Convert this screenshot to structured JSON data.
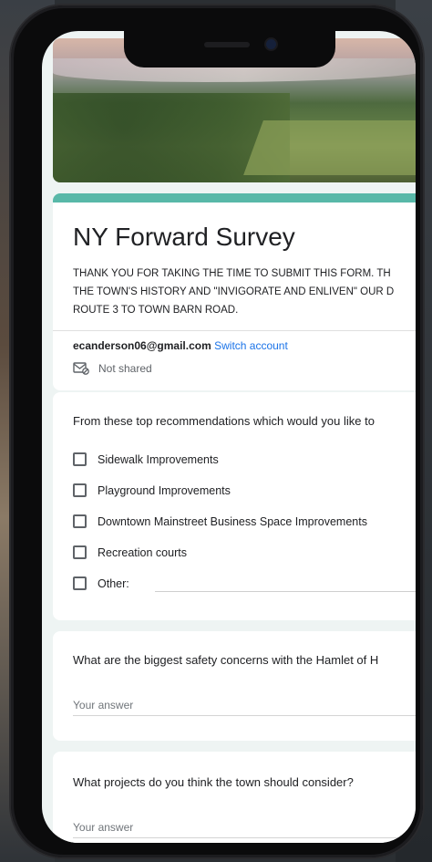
{
  "form": {
    "title": "NY Forward Survey",
    "description_lines": [
      "THANK YOU FOR TAKING THE TIME TO SUBMIT THIS FORM. TH",
      "THE TOWN'S HISTORY AND \"INVIGORATE AND ENLIVEN\" OUR D",
      "ROUTE 3 TO TOWN BARN ROAD."
    ],
    "account_email": "ecanderson06@gmail.com",
    "switch_account_label": "Switch account",
    "not_shared_label": "Not shared"
  },
  "questions": {
    "q1": {
      "text": "From these top recommendations which would you like to",
      "options": [
        "Sidewalk Improvements",
        "Playground Improvements",
        "Downtown Mainstreet Business Space Improvements",
        "Recreation courts",
        "Other:"
      ]
    },
    "q2": {
      "text": "What are the biggest safety concerns with the Hamlet of H",
      "answer_placeholder": "Your answer"
    },
    "q3": {
      "text": "What projects do you think the town should consider?",
      "answer_placeholder": "Your answer"
    }
  },
  "colors": {
    "accent": "#58b8a8",
    "link": "#1a73e8",
    "background": "#eef4f3"
  }
}
